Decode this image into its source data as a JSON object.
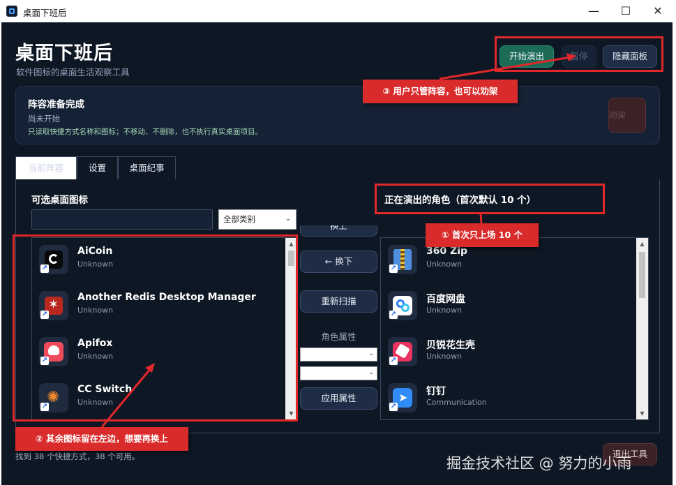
{
  "window": {
    "title": "桌面下班后",
    "minimize": "—",
    "maximize": "☐",
    "close": "✕"
  },
  "header": {
    "title": "桌面下班后",
    "subtitle": "软件图标的桌面生活观察工具"
  },
  "toolbar": {
    "start_label": "开始演出",
    "pause_label": "暂停",
    "hide_label": "隐藏面板"
  },
  "status": {
    "title": "阵容准备完成",
    "subtitle": "尚未开始",
    "note": "只读取快捷方式名称和图标；不移动、不删除，也不执行真实桌面项目。",
    "strike_label": "劝架"
  },
  "tabs": [
    {
      "label": "当前阵容"
    },
    {
      "label": "设置"
    },
    {
      "label": "桌面纪事"
    }
  ],
  "left_panel": {
    "heading": "可选桌面图标",
    "search_value": "",
    "category": "全部类别"
  },
  "right_panel": {
    "heading": "正在演出的角色（首次默认 10 个）"
  },
  "left_items": [
    {
      "name": "AiCoin",
      "category": "Unknown",
      "icon": "aicoin-icon"
    },
    {
      "name": "Another Redis Desktop Manager",
      "category": "Unknown",
      "icon": "redis-icon"
    },
    {
      "name": "Apifox",
      "category": "Unknown",
      "icon": "apifox-icon"
    },
    {
      "name": "CC Switch",
      "category": "Unknown",
      "icon": "cc-switch-icon"
    }
  ],
  "right_items": [
    {
      "name": "360 Zip",
      "category": "Unknown",
      "icon": "zip-icon"
    },
    {
      "name": "百度网盘",
      "category": "Unknown",
      "icon": "baidu-netdisk-icon"
    },
    {
      "name": "贝锐花生壳",
      "category": "Unknown",
      "icon": "peanut-shell-icon"
    },
    {
      "name": "钉钉",
      "category": "Communication",
      "icon": "dingtalk-icon"
    }
  ],
  "middle": {
    "add_label": "换上",
    "swap_label": "← 换下",
    "rescan_label": "重新扫描",
    "attr_label": "角色属性",
    "apply_label": "应用属性"
  },
  "footer": {
    "text": "找到 38 个快捷方式，38 个可用。",
    "exit_label": "退出工具"
  },
  "watermark": "掘金技术社区 @ 努力的小雨",
  "annotations": {
    "callout_toolbar": "③ 用户只管阵容，也可以劝架",
    "callout_right": "① 首次只上场 10 个",
    "callout_left": "② 其余图标留在左边，想要再换上",
    "color": "#e0282a"
  },
  "colors": {
    "accent": "#1d6b57",
    "background": "#0e1724",
    "danger": "#3a2226"
  }
}
